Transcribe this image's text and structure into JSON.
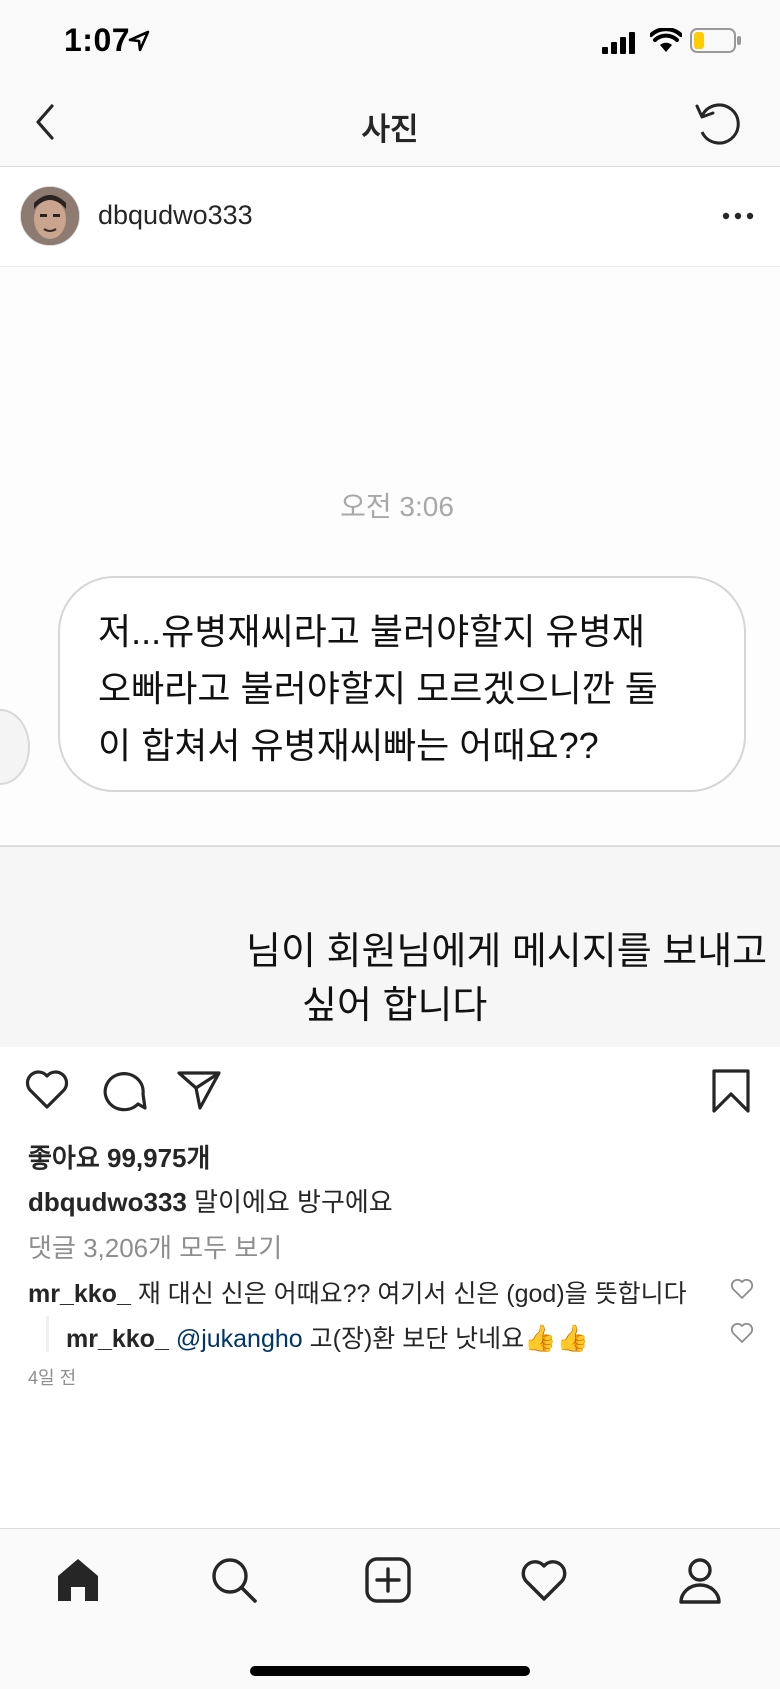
{
  "status_bar": {
    "time": "1:07",
    "battery_color": "#ffcc00"
  },
  "nav": {
    "title": "사진",
    "back_icon": "chevron-left-icon",
    "refresh_icon": "refresh-icon"
  },
  "post": {
    "username": "dbqudwo333",
    "image": {
      "message_time": "오전 3:06",
      "message_lines": [
        "저...유병재씨라고 불러야할지 유병재",
        "오빠라고 불러야할지 모르겠으니깐 둘",
        "이 합쳐서 유병재씨빠는 어때요??"
      ],
      "request_lines": [
        "님이 회원님에게 메시지를 보내고",
        "싶어 합니다"
      ]
    },
    "likes_text": "좋아요 99,975개",
    "caption": {
      "user": "dbqudwo333",
      "text": "말이에요 방구에요"
    },
    "view_comments": "댓글 3,206개 모두 보기",
    "comments": [
      {
        "user": "mr_kko_",
        "mention": "",
        "text": "재 대신 신은 어때요?? 여기서 신은 (god)을 뜻합니다",
        "emoji": ""
      },
      {
        "user": "mr_kko_",
        "mention": "@jukangho",
        "text": "고(장)환 보단 낫네요",
        "emoji": "👍👍"
      }
    ],
    "time_ago": "4일 전"
  },
  "tabs": [
    {
      "name": "home",
      "icon": "home-icon"
    },
    {
      "name": "search",
      "icon": "search-icon"
    },
    {
      "name": "add",
      "icon": "add-post-icon"
    },
    {
      "name": "activity",
      "icon": "heart-icon"
    },
    {
      "name": "profile",
      "icon": "profile-icon"
    }
  ]
}
